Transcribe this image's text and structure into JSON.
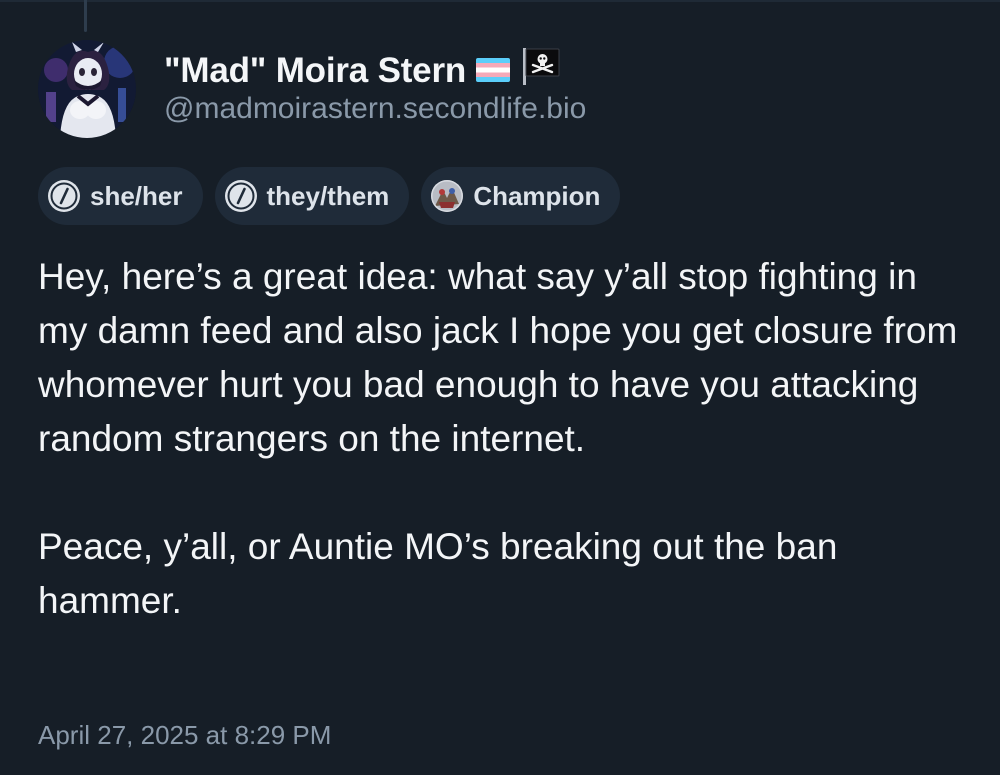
{
  "author": {
    "display_name": "\"Mad\" Moira Stern",
    "handle": "@madmoirastern.secondlife.bio",
    "flags": [
      "trans-flag-icon",
      "pirate-flag-icon"
    ]
  },
  "pronoun_chips": [
    {
      "label": "she/her",
      "icon": "pronoun-slash-icon"
    },
    {
      "label": "they/them",
      "icon": "pronoun-slash-icon"
    },
    {
      "label": "Champion",
      "icon": "champion-badge-icon"
    }
  ],
  "post": {
    "paragraphs": [
      "Hey, here’s a great idea: what say y’all stop fighting in my damn feed and also jack I hope you get closure from whomever hurt you bad enough to have you attacking random strangers on the internet.",
      "Peace, y’all, or Auntie MO’s breaking out the ban hammer."
    ],
    "timestamp": "April 27, 2025 at 8:29 PM"
  },
  "colors": {
    "background": "#161e27",
    "chip_background": "#1f2b39",
    "muted_text": "#8a99a9",
    "trans_blue": "#5bcefa",
    "trans_pink": "#f5a9b8"
  }
}
